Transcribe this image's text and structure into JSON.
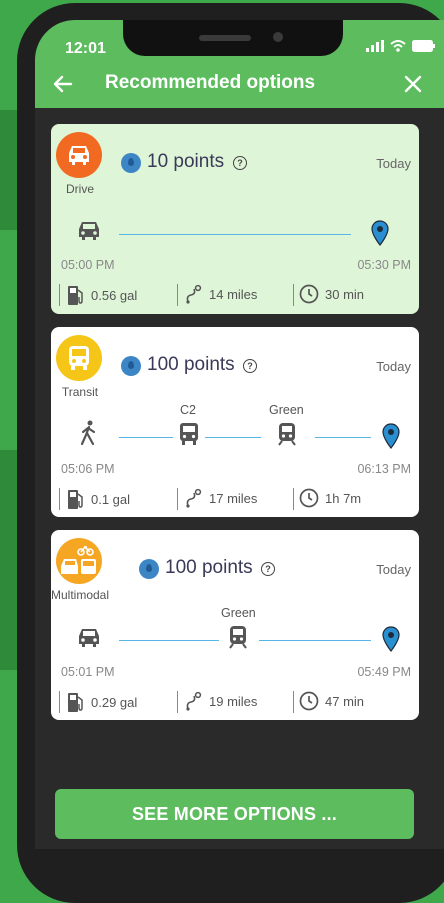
{
  "status_bar": {
    "time": "12:01"
  },
  "header": {
    "title": "Recommended options"
  },
  "options": [
    {
      "mode": "Drive",
      "mode_color": "#f26a21",
      "points": "10 points",
      "date": "Today",
      "depart": "05:00 PM",
      "arrive": "05:30 PM",
      "fuel": "0.56 gal",
      "distance": "14 miles",
      "duration": "30 min",
      "selected": true
    },
    {
      "mode": "Transit",
      "mode_color": "#f5c518",
      "points": "100 points",
      "date": "Today",
      "stops": [
        "C2",
        "Green"
      ],
      "depart": "05:06 PM",
      "arrive": "06:13 PM",
      "fuel": "0.1 gal",
      "distance": "17 miles",
      "duration": "1h 7m",
      "selected": false
    },
    {
      "mode": "Multimodal",
      "mode_color": "#f5a623",
      "points": "100 points",
      "date": "Today",
      "stops": [
        "Green"
      ],
      "depart": "05:01 PM",
      "arrive": "05:49 PM",
      "fuel": "0.29 gal",
      "distance": "19 miles",
      "duration": "47 min",
      "selected": false
    }
  ],
  "footer": {
    "more_label": "SEE MORE OPTIONS ..."
  },
  "colors": {
    "primary_green": "#5cbc5e",
    "route_blue": "#58b6e6",
    "pin_blue": "#2a8fd0"
  }
}
